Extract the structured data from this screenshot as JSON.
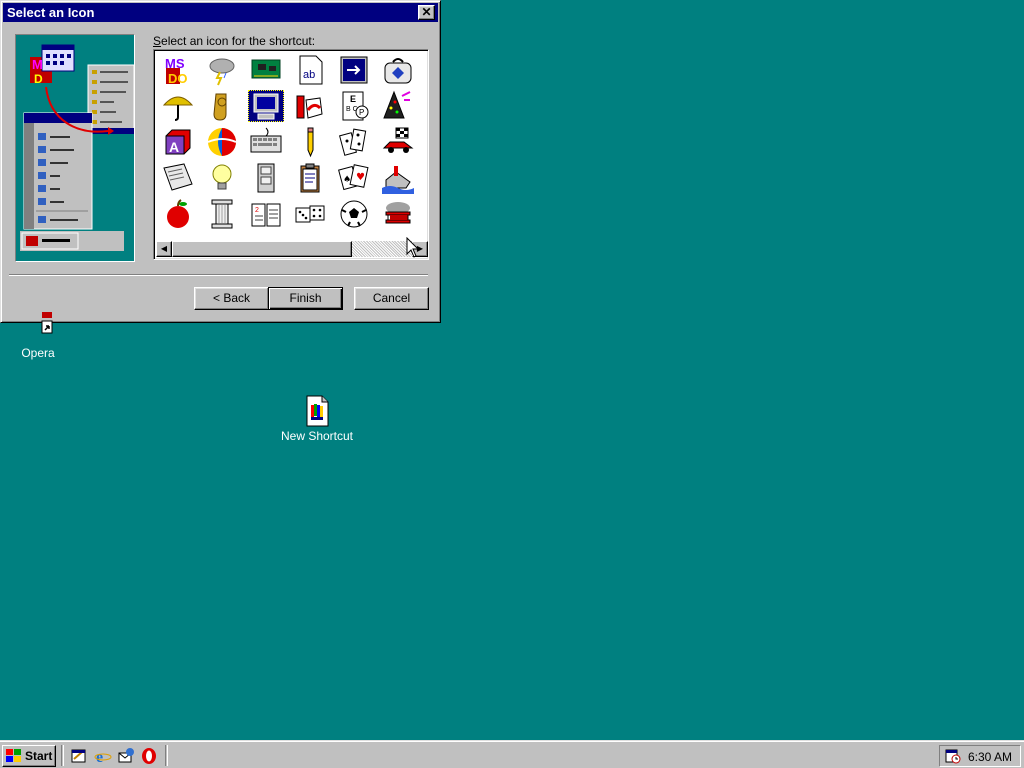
{
  "dialog": {
    "title": "Select an Icon",
    "close_glyph": "✕",
    "prompt_underline": "S",
    "prompt_rest": "elect an icon for the shortcut:",
    "icons": [
      "ms-dos-icon",
      "storm-cloud-icon",
      "circuit-board-icon",
      "notepad-ab-icon",
      "window-arrow-icon",
      "medical-bag-icon",
      "umbrella-icon",
      "tuba-icon",
      "computer-monitor-icon",
      "paint-tubes-icon",
      "eye-chart-icon",
      "party-hat-icon",
      "alphabet-block-icon",
      "beach-ball-icon",
      "keyboard-icon",
      "pencil-icon",
      "dominoes-icon",
      "race-car-icon",
      "newspaper-icon",
      "light-bulb-icon",
      "file-cabinet-icon",
      "clipboard-icon",
      "playing-cards-icon",
      "sinking-ship-icon",
      "apple-icon",
      "column-icon",
      "open-book-icon",
      "dice-icon",
      "soccer-ball-icon",
      "biplane-icon"
    ],
    "selected_icon": "computer-monitor-icon",
    "back_label": "< Back",
    "finish_label": "Finish",
    "cancel_label": "Cancel"
  },
  "desktop": {
    "icons": [
      {
        "label": "Opera",
        "icon": "opera-icon"
      },
      {
        "label": "New Shortcut",
        "icon": "shortcut-file-icon"
      }
    ]
  },
  "taskbar": {
    "start_label": "Start",
    "quick_launch": [
      "show-desktop-icon",
      "internet-explorer-icon",
      "outlook-express-icon",
      "opera-icon"
    ],
    "tray_icon": "scheduler-icon",
    "clock": "6:30 AM"
  },
  "colors": {
    "desktop": "#008080",
    "titlebar": "#000080",
    "face": "#c0c0c0"
  }
}
